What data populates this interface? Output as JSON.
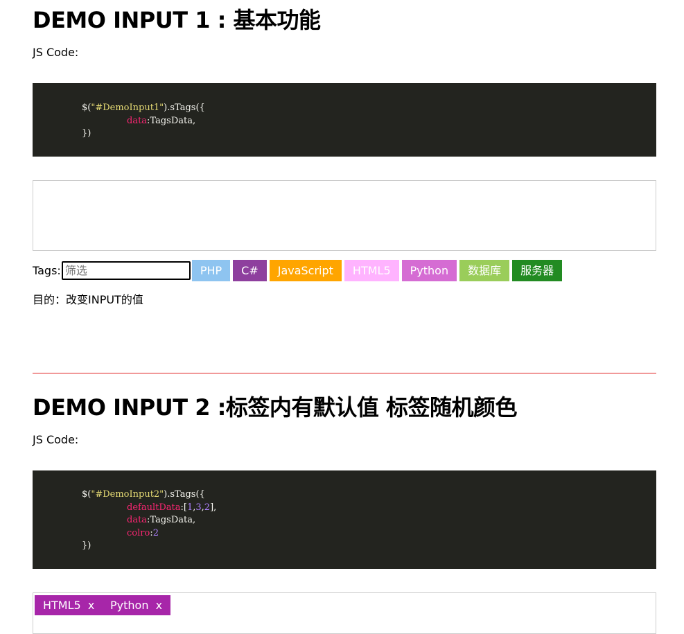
{
  "demo1": {
    "title": "DEMO INPUT 1 : 基本功能",
    "js_label": "JS Code:",
    "code": {
      "l1_a": "$(",
      "l1_str": "\"#DemoInput1\"",
      "l1_b": ").sTags({",
      "l2_key": "data",
      "l2_rest": ":TagsData,",
      "l3": "})"
    },
    "tags_label": "Tags:",
    "filter_placeholder": "筛选",
    "tags": [
      {
        "label": "PHP",
        "color": "#8ec4f0"
      },
      {
        "label": "C#",
        "color": "#8e3f9e"
      },
      {
        "label": "JavaScript",
        "color": "#ffa500"
      },
      {
        "label": "HTML5",
        "color": "#ffb3ff"
      },
      {
        "label": "Python",
        "color": "#d56cd3"
      },
      {
        "label": "数据库",
        "color": "#9acd5a"
      },
      {
        "label": "服务器",
        "color": "#228b22"
      }
    ],
    "purpose": "目的：改变INPUT的值"
  },
  "demo2": {
    "title": "DEMO INPUT 2 :标签内有默认值 标签随机颜色",
    "js_label": "JS Code:",
    "code": {
      "l1_a": "$(",
      "l1_str": "\"#DemoInput2\"",
      "l1_b": ").sTags({",
      "l2_key": "defaultData",
      "l2_p1": ":[",
      "l2_n1": "1",
      "l2_c1": ",",
      "l2_n2": "3",
      "l2_c2": ",",
      "l2_n3": "2",
      "l2_end": "],",
      "l3_key": "data",
      "l3_rest": ":TagsData,",
      "l4_key": "colro",
      "l4_p": ":",
      "l4_n": "2",
      "l5": "})"
    },
    "selected_tags": [
      "HTML5  x",
      "Python  x"
    ],
    "selected_color": "#a726a9"
  },
  "divider_color": "#e02020"
}
